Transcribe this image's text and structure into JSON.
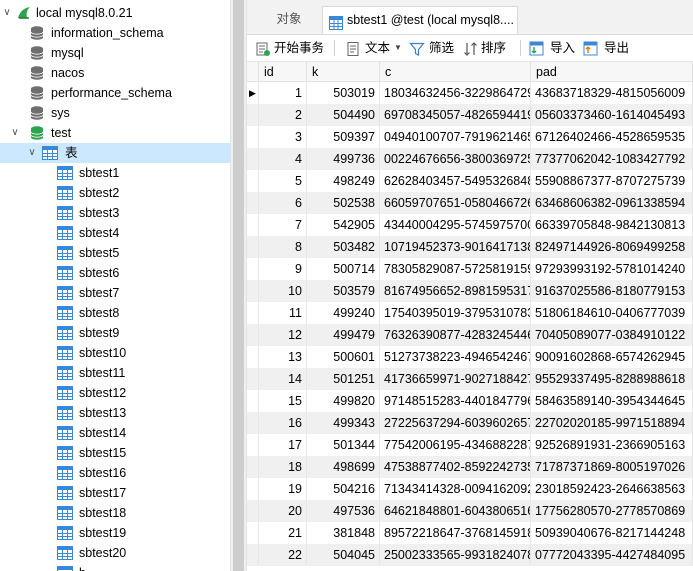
{
  "tree": {
    "connection": "local mysql8.0.21",
    "databases": [
      "information_schema",
      "mysql",
      "nacos",
      "performance_schema",
      "sys",
      "test"
    ],
    "tables_folder": "表",
    "tables": [
      "sbtest1",
      "sbtest2",
      "sbtest3",
      "sbtest4",
      "sbtest5",
      "sbtest6",
      "sbtest7",
      "sbtest8",
      "sbtest9",
      "sbtest10",
      "sbtest11",
      "sbtest12",
      "sbtest13",
      "sbtest14",
      "sbtest15",
      "sbtest16",
      "sbtest17",
      "sbtest18",
      "sbtest19",
      "sbtest20"
    ],
    "partial_last": "b..."
  },
  "tabs": {
    "objects": "对象",
    "active": "sbtest1 @test (local mysql8...."
  },
  "toolbar": {
    "begin_transaction": "开始事务",
    "text": "文本",
    "filter": "筛选",
    "sort": "排序",
    "import": "导入",
    "export": "导出"
  },
  "grid": {
    "columns": [
      "id",
      "k",
      "c",
      "pad"
    ],
    "rows": [
      [
        "1",
        "503019",
        "18034632456-3229864729",
        "43683718329-4815056009"
      ],
      [
        "2",
        "504490",
        "69708345057-4826594419",
        "05603373460-1614045493"
      ],
      [
        "3",
        "509397",
        "04940100707-7919621465",
        "67126402466-4528659535"
      ],
      [
        "4",
        "499736",
        "00224676656-3800369725",
        "77377062042-1083427792"
      ],
      [
        "5",
        "498249",
        "62628403457-5495326848",
        "55908867377-8707275739"
      ],
      [
        "6",
        "502538",
        "66059707651-0580466726",
        "63468606382-0961338594"
      ],
      [
        "7",
        "542905",
        "43440004295-5745975700",
        "66339705848-9842130813"
      ],
      [
        "8",
        "503482",
        "10719452373-9016417138",
        "82497144926-8069499258"
      ],
      [
        "9",
        "500714",
        "78305829087-5725819159",
        "97293993192-5781014240"
      ],
      [
        "10",
        "503579",
        "81674956652-8981595317",
        "91637025586-8180779153"
      ],
      [
        "11",
        "499240",
        "17540395019-3795310783",
        "51806184610-0406777039"
      ],
      [
        "12",
        "499479",
        "76326390877-4283245446",
        "70405089077-0384910122"
      ],
      [
        "13",
        "500601",
        "51273738223-4946542467",
        "90091602868-6574262945"
      ],
      [
        "14",
        "501251",
        "41736659971-9027188427",
        "95529337495-8288988618"
      ],
      [
        "15",
        "499820",
        "97148515283-4401847796",
        "58463589140-3954344645"
      ],
      [
        "16",
        "499343",
        "27225637294-6039602657",
        "22702020185-9971518894"
      ],
      [
        "17",
        "501344",
        "77542006195-4346882287",
        "92526891931-2366905163"
      ],
      [
        "18",
        "498699",
        "47538877402-8592242735",
        "71787371869-8005197026"
      ],
      [
        "19",
        "504216",
        "71343414328-0094162092",
        "23018592423-2646638563"
      ],
      [
        "20",
        "497536",
        "64621848801-6043806516",
        "17756280570-2778570869"
      ],
      [
        "21",
        "381848",
        "89572218647-3768145918",
        "50939040676-8217144248"
      ],
      [
        "22",
        "504045",
        "25002333565-9931824078",
        "07772043395-4427484095"
      ]
    ]
  },
  "colors": {
    "selection": "#cce8ff",
    "db_icon": "#6e6e6e",
    "db_active_icon": "#2ea44f",
    "table_icon": "#3a87d6",
    "alt_row": "#f0f0f0"
  }
}
